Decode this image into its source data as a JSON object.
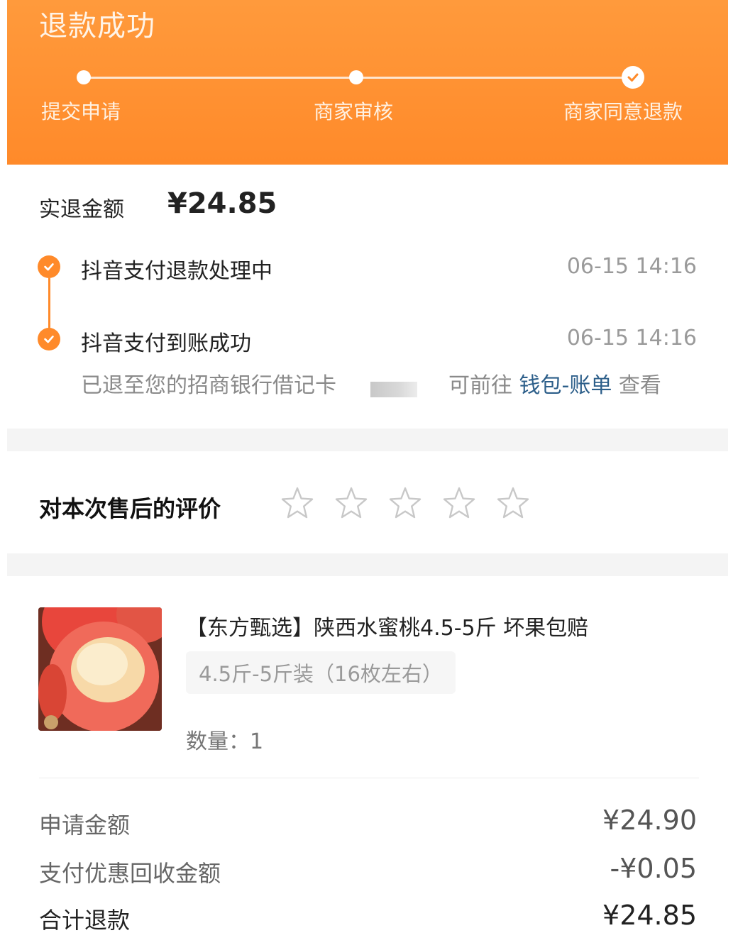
{
  "header": {
    "title": "退款成功",
    "steps": [
      {
        "label": "提交申请"
      },
      {
        "label": "商家审核"
      },
      {
        "label": "商家同意退款"
      }
    ]
  },
  "refund": {
    "label": "实退金额",
    "amount": "¥24.85",
    "timeline": [
      {
        "text": "抖音支付退款处理中",
        "time": "06-15 14:16"
      },
      {
        "text": "抖音支付到账成功",
        "time": "06-15 14:16"
      }
    ],
    "note_prefix": "已退至您的招商银行借记卡",
    "note_goto": "可前往",
    "note_link": "钱包-账单",
    "note_suffix": "查看"
  },
  "rating": {
    "label": "对本次售后的评价",
    "stars": 0,
    "max": 5
  },
  "product": {
    "title": "【东方甄选】陕西水蜜桃4.5-5斤 坏果包赔",
    "spec": "4.5斤-5斤装（16枚左右）",
    "quantity": "数量：1"
  },
  "summary": [
    {
      "label": "申请金额",
      "value": "¥24.90"
    },
    {
      "label": "支付优惠回收金额",
      "value": "-¥0.05"
    },
    {
      "label": "合计退款",
      "value": "¥24.85"
    }
  ],
  "colors": {
    "accent": "#ff8a2a",
    "link": "#2d5f8a"
  }
}
